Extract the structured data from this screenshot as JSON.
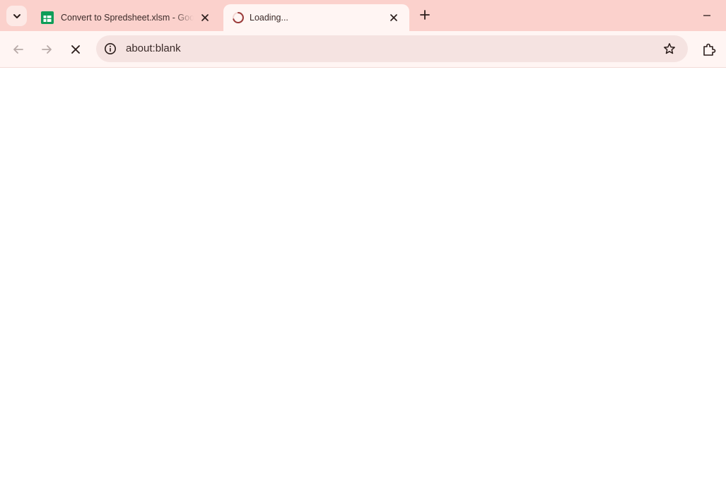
{
  "colors": {
    "tabstrip_bg": "#fbd1cc",
    "active_tab_bg": "#fff5f3",
    "omnibox_bg": "#f5e3e1",
    "text": "#3a2a28",
    "sheets_green": "#0f9d58",
    "loading_spinner": "#9a3a3a"
  },
  "tabs": [
    {
      "title": "Convert to Spredsheet.xlsm - Goog",
      "favicon": "google-sheets-icon",
      "active": false
    },
    {
      "title": "Loading...",
      "favicon": "loading-spinner-icon",
      "active": true
    }
  ],
  "toolbar": {
    "back_icon": "arrow-left-icon",
    "forward_icon": "arrow-right-icon",
    "stop_icon": "close-icon"
  },
  "omnibox": {
    "url": "about:blank",
    "info_icon": "info-icon",
    "bookmark_icon": "star-icon"
  },
  "window": {
    "tab_search_icon": "chevron-down-icon",
    "new_tab_icon": "plus-icon",
    "minimize_icon": "minimize-icon",
    "extensions_icon": "puzzle-icon"
  }
}
